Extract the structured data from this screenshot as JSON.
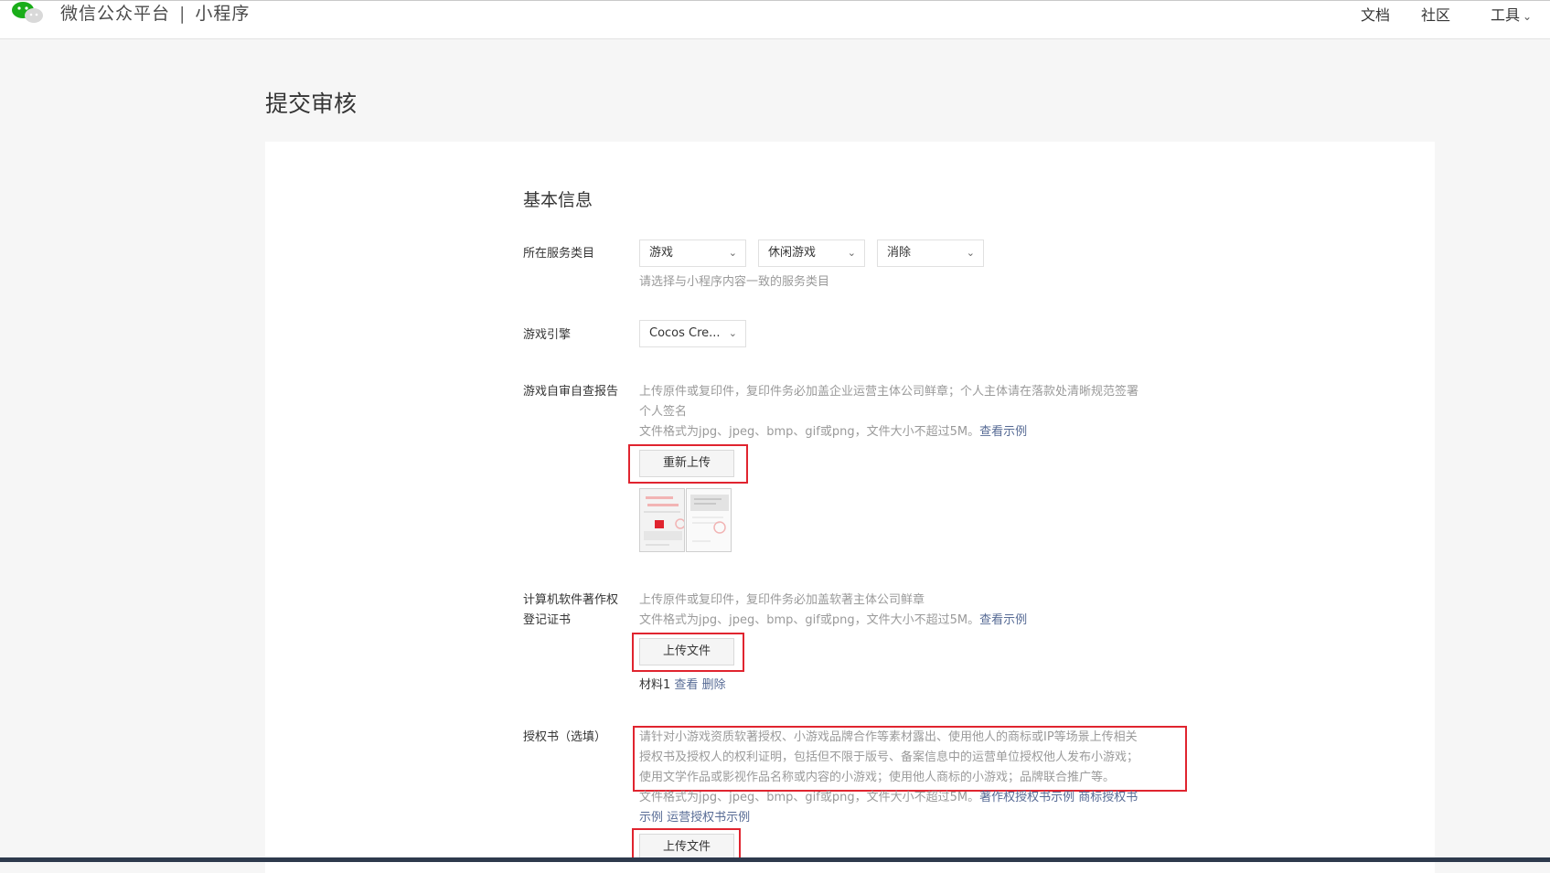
{
  "header": {
    "brand": "微信公众平台",
    "separator": "|",
    "product": "小程序",
    "nav": [
      {
        "label": "文档"
      },
      {
        "label": "社区"
      },
      {
        "label": "工具"
      }
    ]
  },
  "page": {
    "title": "提交审核"
  },
  "basic_info": {
    "section_title": "基本信息",
    "category": {
      "label": "所在服务类目",
      "selects": [
        "游戏",
        "休闲游戏",
        "消除"
      ],
      "hint": "请选择与小程序内容一致的服务类目"
    },
    "engine": {
      "label": "游戏引擎",
      "value": "Cocos Cre..."
    },
    "self_check": {
      "label": "游戏自审自查报告",
      "desc_line1": "上传原件或复印件，复印件务必加盖企业运营主体公司鲜章；个人主体请在落款处清晰规范签署",
      "desc_line2": "个人签名",
      "format": "文件格式为jpg、jpeg、bmp、gif或png，文件大小不超过5M。",
      "example_link": "查看示例",
      "button": "重新上传"
    },
    "copyright": {
      "label_line1": "计算机软件著作权",
      "label_line2": "登记证书",
      "desc": "上传原件或复印件，复印件务必加盖软著主体公司鲜章",
      "format": "文件格式为jpg、jpeg、bmp、gif或png，文件大小不超过5M。",
      "example_link": "查看示例",
      "button": "上传文件",
      "file_name": "材料1",
      "view_link": "查看",
      "delete_link": "删除"
    },
    "authorization": {
      "label": "授权书（选填）",
      "desc_line1": "请针对小游戏资质软著授权、小游戏品牌合作等素材露出、使用他人的商标或IP等场景上传相关",
      "desc_line2": "授权书及授权人的权利证明，包括但不限于版号、备案信息中的运营单位授权他人发布小游戏；",
      "desc_line3": "使用文学作品或影视作品名称或内容的小游戏；使用他人商标的小游戏；品牌联合推广等。",
      "format": "文件格式为jpg、jpeg、bmp、gif或png，文件大小不超过5M。",
      "link1": "著作权授权书示例",
      "link2": "商标授权书",
      "link2_cont": "示例",
      "link3": "运营授权书示例",
      "button": "上传文件"
    }
  },
  "colors": {
    "highlight": "#e0242f",
    "link": "#576b95",
    "wechat_green": "#1aad19"
  }
}
